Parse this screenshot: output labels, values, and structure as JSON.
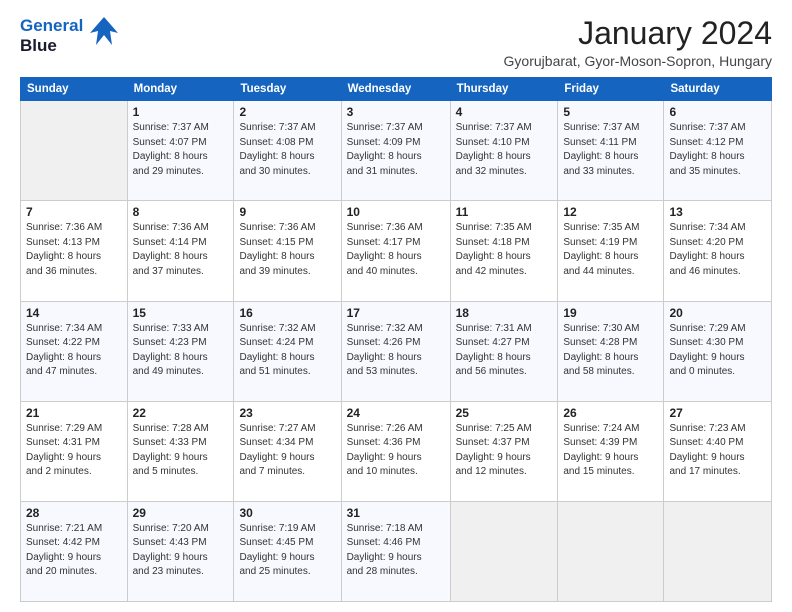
{
  "logo": {
    "line1": "General",
    "line2": "Blue"
  },
  "title": "January 2024",
  "subtitle": "Gyorujbarat, Gyor-Moson-Sopron, Hungary",
  "weekdays": [
    "Sunday",
    "Monday",
    "Tuesday",
    "Wednesday",
    "Thursday",
    "Friday",
    "Saturday"
  ],
  "weeks": [
    [
      {
        "num": "",
        "info": ""
      },
      {
        "num": "1",
        "info": "Sunrise: 7:37 AM\nSunset: 4:07 PM\nDaylight: 8 hours\nand 29 minutes."
      },
      {
        "num": "2",
        "info": "Sunrise: 7:37 AM\nSunset: 4:08 PM\nDaylight: 8 hours\nand 30 minutes."
      },
      {
        "num": "3",
        "info": "Sunrise: 7:37 AM\nSunset: 4:09 PM\nDaylight: 8 hours\nand 31 minutes."
      },
      {
        "num": "4",
        "info": "Sunrise: 7:37 AM\nSunset: 4:10 PM\nDaylight: 8 hours\nand 32 minutes."
      },
      {
        "num": "5",
        "info": "Sunrise: 7:37 AM\nSunset: 4:11 PM\nDaylight: 8 hours\nand 33 minutes."
      },
      {
        "num": "6",
        "info": "Sunrise: 7:37 AM\nSunset: 4:12 PM\nDaylight: 8 hours\nand 35 minutes."
      }
    ],
    [
      {
        "num": "7",
        "info": "Sunrise: 7:36 AM\nSunset: 4:13 PM\nDaylight: 8 hours\nand 36 minutes."
      },
      {
        "num": "8",
        "info": "Sunrise: 7:36 AM\nSunset: 4:14 PM\nDaylight: 8 hours\nand 37 minutes."
      },
      {
        "num": "9",
        "info": "Sunrise: 7:36 AM\nSunset: 4:15 PM\nDaylight: 8 hours\nand 39 minutes."
      },
      {
        "num": "10",
        "info": "Sunrise: 7:36 AM\nSunset: 4:17 PM\nDaylight: 8 hours\nand 40 minutes."
      },
      {
        "num": "11",
        "info": "Sunrise: 7:35 AM\nSunset: 4:18 PM\nDaylight: 8 hours\nand 42 minutes."
      },
      {
        "num": "12",
        "info": "Sunrise: 7:35 AM\nSunset: 4:19 PM\nDaylight: 8 hours\nand 44 minutes."
      },
      {
        "num": "13",
        "info": "Sunrise: 7:34 AM\nSunset: 4:20 PM\nDaylight: 8 hours\nand 46 minutes."
      }
    ],
    [
      {
        "num": "14",
        "info": "Sunrise: 7:34 AM\nSunset: 4:22 PM\nDaylight: 8 hours\nand 47 minutes."
      },
      {
        "num": "15",
        "info": "Sunrise: 7:33 AM\nSunset: 4:23 PM\nDaylight: 8 hours\nand 49 minutes."
      },
      {
        "num": "16",
        "info": "Sunrise: 7:32 AM\nSunset: 4:24 PM\nDaylight: 8 hours\nand 51 minutes."
      },
      {
        "num": "17",
        "info": "Sunrise: 7:32 AM\nSunset: 4:26 PM\nDaylight: 8 hours\nand 53 minutes."
      },
      {
        "num": "18",
        "info": "Sunrise: 7:31 AM\nSunset: 4:27 PM\nDaylight: 8 hours\nand 56 minutes."
      },
      {
        "num": "19",
        "info": "Sunrise: 7:30 AM\nSunset: 4:28 PM\nDaylight: 8 hours\nand 58 minutes."
      },
      {
        "num": "20",
        "info": "Sunrise: 7:29 AM\nSunset: 4:30 PM\nDaylight: 9 hours\nand 0 minutes."
      }
    ],
    [
      {
        "num": "21",
        "info": "Sunrise: 7:29 AM\nSunset: 4:31 PM\nDaylight: 9 hours\nand 2 minutes."
      },
      {
        "num": "22",
        "info": "Sunrise: 7:28 AM\nSunset: 4:33 PM\nDaylight: 9 hours\nand 5 minutes."
      },
      {
        "num": "23",
        "info": "Sunrise: 7:27 AM\nSunset: 4:34 PM\nDaylight: 9 hours\nand 7 minutes."
      },
      {
        "num": "24",
        "info": "Sunrise: 7:26 AM\nSunset: 4:36 PM\nDaylight: 9 hours\nand 10 minutes."
      },
      {
        "num": "25",
        "info": "Sunrise: 7:25 AM\nSunset: 4:37 PM\nDaylight: 9 hours\nand 12 minutes."
      },
      {
        "num": "26",
        "info": "Sunrise: 7:24 AM\nSunset: 4:39 PM\nDaylight: 9 hours\nand 15 minutes."
      },
      {
        "num": "27",
        "info": "Sunrise: 7:23 AM\nSunset: 4:40 PM\nDaylight: 9 hours\nand 17 minutes."
      }
    ],
    [
      {
        "num": "28",
        "info": "Sunrise: 7:21 AM\nSunset: 4:42 PM\nDaylight: 9 hours\nand 20 minutes."
      },
      {
        "num": "29",
        "info": "Sunrise: 7:20 AM\nSunset: 4:43 PM\nDaylight: 9 hours\nand 23 minutes."
      },
      {
        "num": "30",
        "info": "Sunrise: 7:19 AM\nSunset: 4:45 PM\nDaylight: 9 hours\nand 25 minutes."
      },
      {
        "num": "31",
        "info": "Sunrise: 7:18 AM\nSunset: 4:46 PM\nDaylight: 9 hours\nand 28 minutes."
      },
      {
        "num": "",
        "info": ""
      },
      {
        "num": "",
        "info": ""
      },
      {
        "num": "",
        "info": ""
      }
    ]
  ]
}
